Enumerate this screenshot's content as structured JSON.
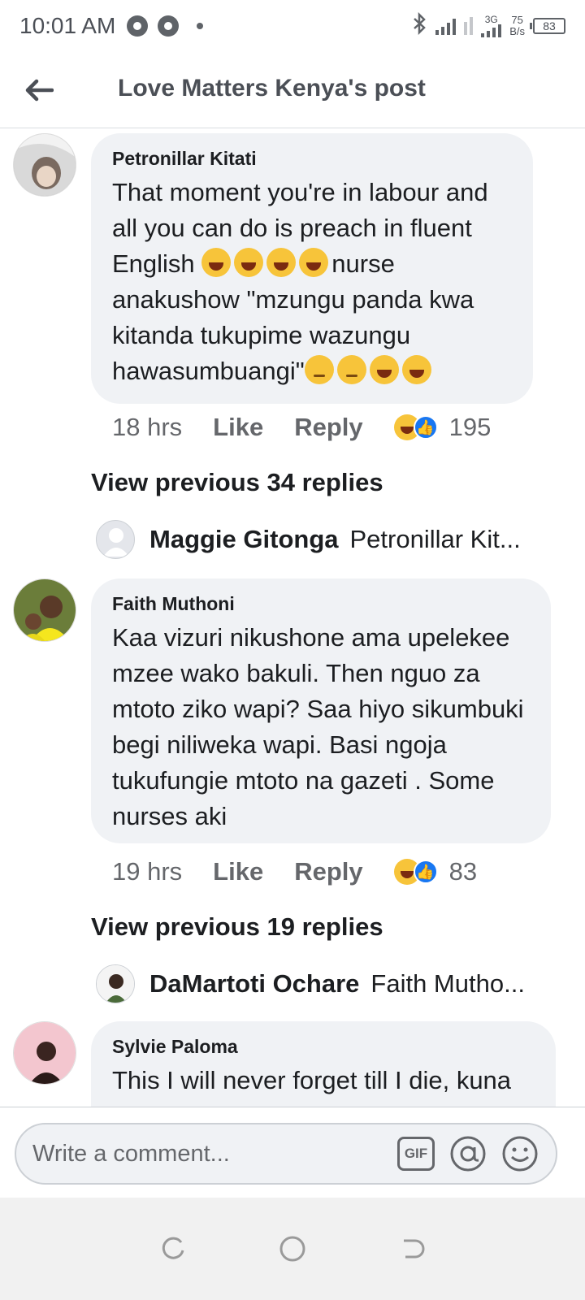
{
  "status_bar": {
    "time": "10:01 AM",
    "network_type": "3G",
    "speed_value": "75",
    "speed_unit": "B/s",
    "battery": "83"
  },
  "header": {
    "title": "Love Matters Kenya's post"
  },
  "comments": [
    {
      "author": "Petronillar Kitati",
      "text_parts": [
        "That moment you're in labour and all you can do is preach in fluent English ",
        "nurse anakushow \"mzungu panda kwa kitanda tukupime wazungu hawasumbuangi\""
      ],
      "time": "18 hrs",
      "like_label": "Like",
      "reply_label": "Reply",
      "reaction_count": "195",
      "view_previous": "View previous 34 replies",
      "latest_reply": {
        "name": "Maggie Gitonga",
        "snippet": "Petronillar Kit..."
      }
    },
    {
      "author": "Faith Muthoni",
      "text": "Kaa vizuri nikushone ama upelekee mzee wako bakuli. Then nguo za mtoto ziko wapi? Saa hiyo sikumbuki begi niliweka wapi. Basi ngoja tukufungie mtoto na gazeti . Some nurses aki",
      "time": "19 hrs",
      "like_label": "Like",
      "reply_label": "Reply",
      "reaction_count": "83",
      "view_previous": "View previous 19 replies",
      "latest_reply": {
        "name": "DaMartoti Ochare",
        "snippet": "Faith Mutho..."
      }
    },
    {
      "author": "Sylvie Paloma",
      "text": "This I will never forget till I die, kuna"
    }
  ],
  "composer": {
    "placeholder": "Write a comment...",
    "gif_label": "GIF"
  },
  "colors": {
    "bubble": "#f0f2f5",
    "like_blue": "#1877f2",
    "muted_text": "#65676b"
  }
}
